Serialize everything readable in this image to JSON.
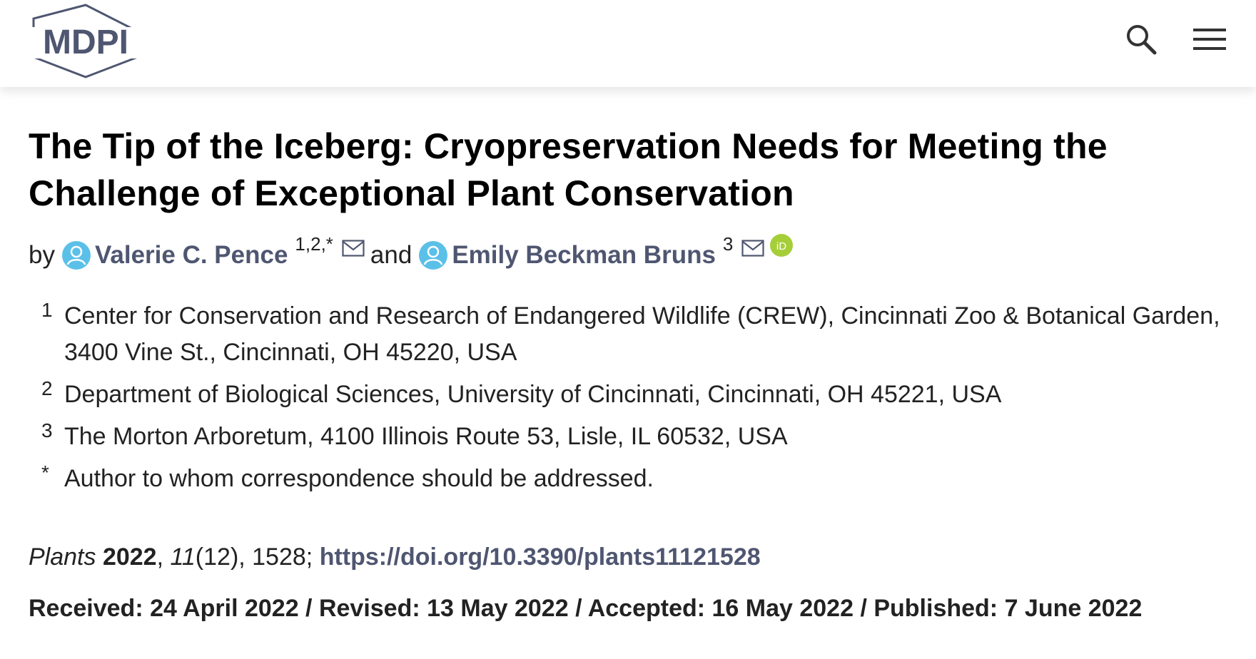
{
  "header": {
    "logo_text": "MDPI",
    "search_icon": "search-icon",
    "menu_icon": "hamburger-menu-icon"
  },
  "article": {
    "title": "The Tip of the Iceberg: Cryopreservation Needs for Meeting the Challenge of Exceptional Plant Conservation",
    "by_label": "by",
    "and_label": "and",
    "authors": [
      {
        "name": "Valerie C. Pence",
        "sup": "1,2,*",
        "email_icon": true,
        "orcid_icon": false
      },
      {
        "name": "Emily Beckman Bruns",
        "sup": "3",
        "email_icon": true,
        "orcid_icon": true
      }
    ],
    "affiliations": [
      {
        "num": "1",
        "text": "Center for Conservation and Research of Endangered Wildlife (CREW), Cincinnati Zoo & Botanical Garden, 3400 Vine St., Cincinnati, OH 45220, USA"
      },
      {
        "num": "2",
        "text": "Department of Biological Sciences, University of Cincinnati, Cincinnati, OH 45221, USA"
      },
      {
        "num": "3",
        "text": "The Morton Arboretum, 4100 Illinois Route 53, Lisle, IL 60532, USA"
      },
      {
        "num": "*",
        "text": "Author to whom correspondence should be addressed."
      }
    ],
    "citation": {
      "journal": "Plants",
      "year": "2022",
      "volume": "11",
      "issue_pages": "(12), 1528; ",
      "doi": "https://doi.org/10.3390/plants11121528"
    },
    "dates": "Received: 24 April 2022 / Revised: 13 May 2022 / Accepted: 16 May 2022 / Published: 7 June 2022"
  },
  "colors": {
    "link": "#4f5671",
    "person_icon": "#5bc0e8",
    "orcid": "#a6ce39"
  }
}
